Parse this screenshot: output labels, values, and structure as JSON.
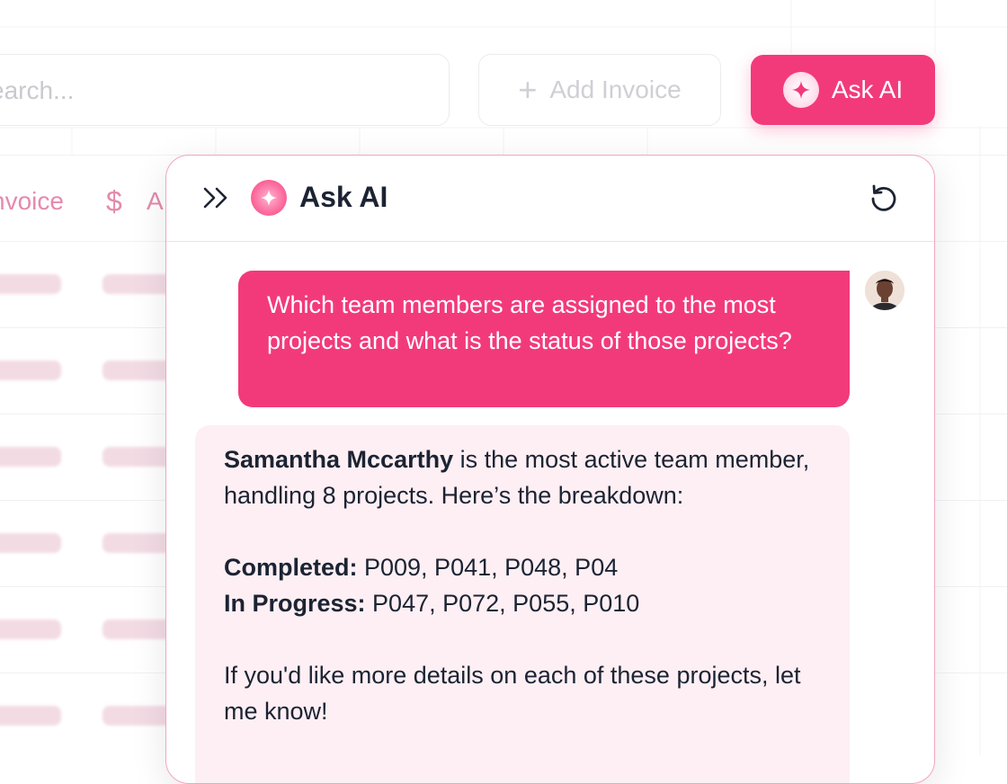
{
  "toolbar": {
    "search_placeholder": "earch...",
    "add_invoice_label": "Add Invoice",
    "ask_ai_label": "Ask AI"
  },
  "table": {
    "header_invoice": "nvoice",
    "header_amount_icon": "$",
    "header_amount_partial": "A"
  },
  "chat": {
    "title": "Ask AI",
    "user_message": "Which team members are assigned to the most projects and what is the status of those projects?",
    "reply": {
      "name": "Samantha Mccarthy",
      "intro_rest": " is the most active team member, handling 8 projects. Here’s the breakdown:",
      "completed_label": "Completed:",
      "completed_values": " P009, P041, P048, P04",
      "in_progress_label": "In Progress:",
      "in_progress_values": " P047, P072, P055, P010",
      "closing": "If you'd like more details on each of these projects, let me know!"
    }
  },
  "colors": {
    "accent": "#f23a7b",
    "ai_bubble_bg": "#fdeff3",
    "text_dark": "#1c2333"
  },
  "icons": {
    "collapse": "chevrons-right-icon",
    "sparkle": "sparkle-icon",
    "reset": "rotate-ccw-icon",
    "plus": "plus-icon",
    "dollar": "dollar-icon"
  }
}
